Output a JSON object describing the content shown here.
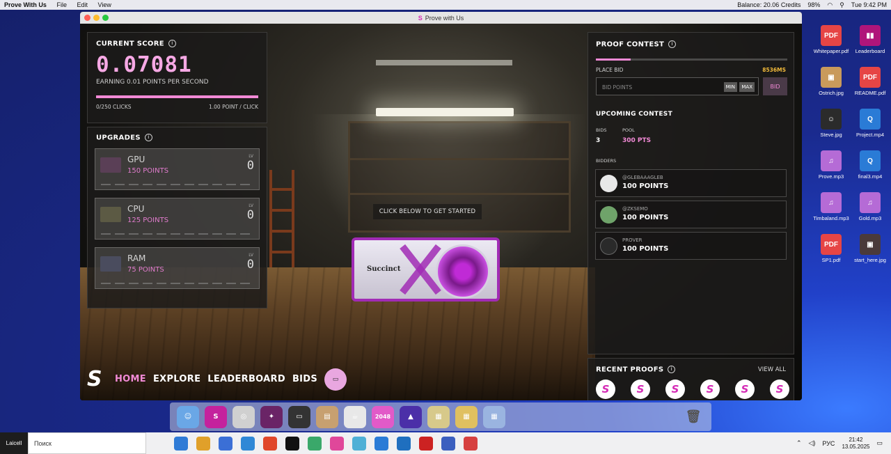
{
  "menubar": {
    "app_name": "Prove With Us",
    "items": [
      "File",
      "Edit",
      "View"
    ],
    "balance": "Balance: 20.06 Credits",
    "battery": "98%",
    "clock": "Tue 9:42 PM"
  },
  "window": {
    "title": "Prove with Us"
  },
  "score_panel": {
    "title": "CURRENT SCORE",
    "score": "0.07081",
    "earning": "EARNING 0.01 POINTS PER SECOND",
    "clicks": "0/250 CLICKS",
    "per_click": "1.00 POINT / CLICK",
    "progress": 1.0
  },
  "upgrades": {
    "title": "UPGRADES",
    "items": [
      {
        "name": "GPU",
        "points": "150 POINTS",
        "lv_label": "LV",
        "level": "0"
      },
      {
        "name": "CPU",
        "points": "125 POINTS",
        "lv_label": "LV",
        "level": "0"
      },
      {
        "name": "RAM",
        "points": "75 POINTS",
        "lv_label": "LV",
        "level": "0"
      }
    ]
  },
  "scene": {
    "hint": "CLICK BELOW TO GET STARTED",
    "gpu_brand": "Succinct"
  },
  "proof_contest": {
    "title": "PROOF CONTEST",
    "place_bid": "PLACE BID",
    "timer": "8536MS",
    "bid_placeholder": "BID POINTS",
    "min": "MIN",
    "max": "MAX",
    "bid_button": "BID",
    "progress": 0.18,
    "upcoming_title": "UPCOMING CONTEST",
    "bids_label": "BIDS",
    "bids_value": "3",
    "pool_label": "POOL",
    "pool_value": "300 PTS",
    "bidders_label": "BIDDERS",
    "bidders": [
      {
        "handle": "@GLEBAAAGLEB",
        "points": "100 POINTS"
      },
      {
        "handle": "@ZKSEMO",
        "points": "100 POINTS"
      },
      {
        "handle": "PROVER",
        "points": "100 POINTS"
      }
    ]
  },
  "recent_proofs": {
    "title": "RECENT PROOFS",
    "view_all": "VIEW ALL",
    "count": 6
  },
  "nav": {
    "logo": "S",
    "items": [
      "HOME",
      "EXPLORE",
      "LEADERBOARD",
      "BIDS"
    ],
    "active": "HOME"
  },
  "desktop_icons": [
    {
      "label": "Whitepaper.pdf",
      "color": "#e64545",
      "glyph": "PDF"
    },
    {
      "label": "Leaderboard",
      "color": "#b0157a",
      "glyph": "▮▮"
    },
    {
      "label": "Ostrich.jpg",
      "color": "#c99a5b",
      "glyph": "▣"
    },
    {
      "label": "README.pdf",
      "color": "#e64545",
      "glyph": "PDF"
    },
    {
      "label": "Steve.jpg",
      "color": "#2b2b2b",
      "glyph": "☺"
    },
    {
      "label": "Project.mp4",
      "color": "#2a7bd6",
      "glyph": "Q"
    },
    {
      "label": "Prove.mp3",
      "color": "#b56bd6",
      "glyph": "♫"
    },
    {
      "label": "final3.mp4",
      "color": "#2a7bd6",
      "glyph": "Q"
    },
    {
      "label": "Timbaland.mp3",
      "color": "#b56bd6",
      "glyph": "♫"
    },
    {
      "label": "Gold.mp3",
      "color": "#b56bd6",
      "glyph": "♫"
    },
    {
      "label": "SP1.pdf",
      "color": "#e64545",
      "glyph": "PDF"
    },
    {
      "label": "start_here.jpg",
      "color": "#4a3a3a",
      "glyph": "▣"
    }
  ],
  "dock": {
    "apps": [
      {
        "name": "finder",
        "color": "#6aa7e6",
        "glyph": "☺"
      },
      {
        "name": "succinct",
        "color": "#c4229d",
        "glyph": "S"
      },
      {
        "name": "network",
        "color": "#d0d0d0",
        "glyph": "◎"
      },
      {
        "name": "prove-app",
        "color": "#6a2466",
        "glyph": "✦"
      },
      {
        "name": "terminal",
        "color": "#333",
        "glyph": "▭"
      },
      {
        "name": "wallet",
        "color": "#c7a070",
        "glyph": "▤"
      },
      {
        "name": "tea",
        "color": "#e8e8e8",
        "glyph": "☕"
      },
      {
        "name": "game-2048",
        "color": "#e25ac8",
        "glyph": "2048"
      },
      {
        "name": "arcade",
        "color": "#4b2fa8",
        "glyph": "▲"
      },
      {
        "name": "tiles-1",
        "color": "#d7c98a",
        "glyph": "▦"
      },
      {
        "name": "tiles-2",
        "color": "#e0c060",
        "glyph": "▦"
      },
      {
        "name": "tiles-3",
        "color": "#9ab4e0",
        "glyph": "▦"
      }
    ]
  },
  "taskbar": {
    "start_label": "Laicell",
    "search_placeholder": "Поиск",
    "lang": "РУС",
    "time": "21:42",
    "date": "13.05.2025",
    "apps": [
      "#2f7bd6",
      "#e0a02a",
      "#3b6fd6",
      "#2f88d6",
      "#e0472a",
      "#111",
      "#3aa86a",
      "#e0479a",
      "#4fb0d6",
      "#2a7bd6",
      "#1f6fbf",
      "#c22",
      "#3b5fbf",
      "#d64040"
    ]
  }
}
